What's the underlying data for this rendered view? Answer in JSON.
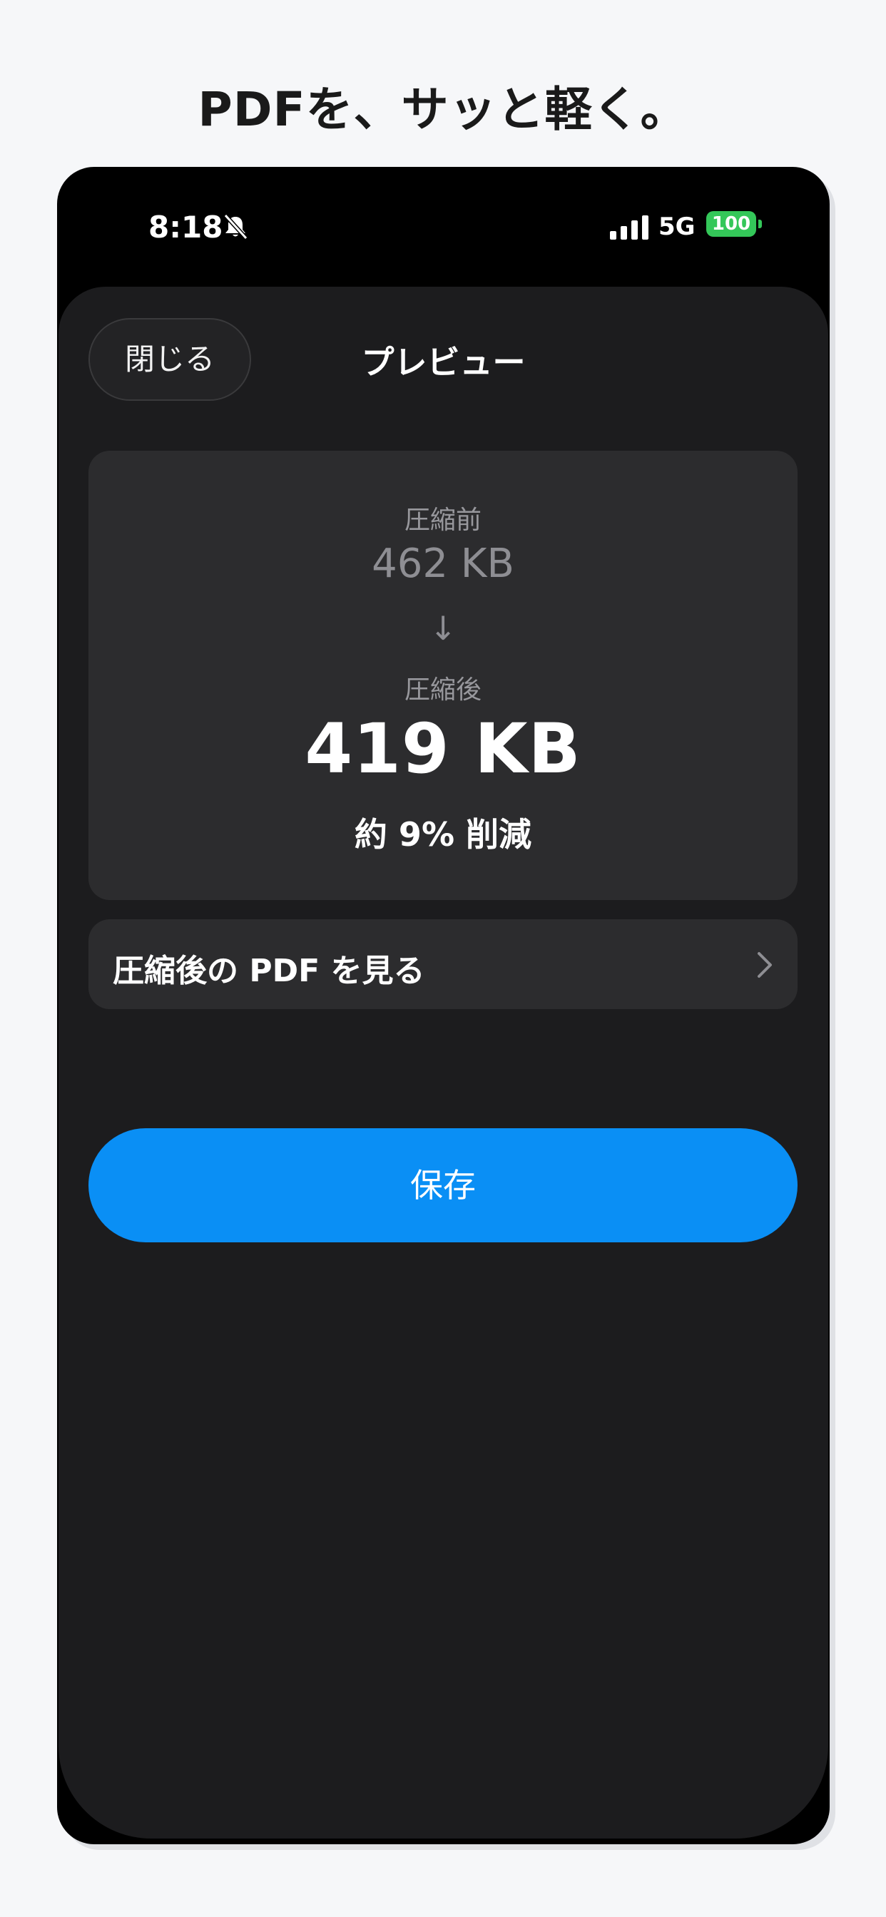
{
  "headline": "PDFを、サッと軽く。",
  "status_bar": {
    "time": "8:18",
    "network": "5G",
    "battery": "100",
    "battery_color": "#34c759"
  },
  "header": {
    "close_label": "閉じる",
    "title": "プレビュー"
  },
  "stats": {
    "before_label": "圧縮前",
    "before_value": "462 KB",
    "arrow": "↓",
    "after_label": "圧縮後",
    "after_value": "419 KB",
    "reduction": "約 9% 削減"
  },
  "view_row": {
    "label": "圧縮後の PDF を見る"
  },
  "save_button": {
    "label": "保存",
    "color": "#0a8ff5"
  },
  "icons": {
    "bell": "bell-slash-icon",
    "signal": "signal-icon",
    "chevron": "chevron-right-icon"
  }
}
